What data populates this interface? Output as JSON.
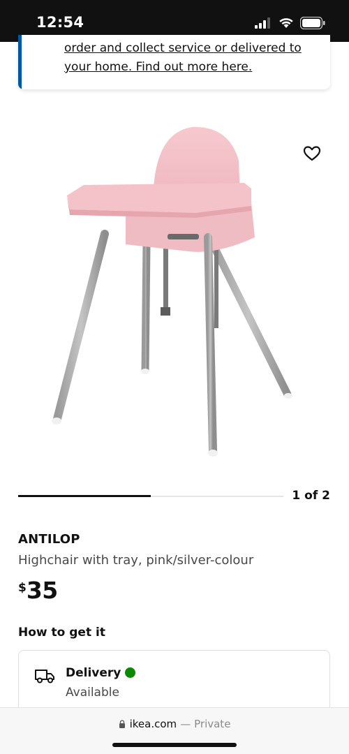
{
  "status_bar": {
    "time": "12:54",
    "icons": [
      "signal-icon",
      "wifi-icon",
      "battery-icon"
    ]
  },
  "info_banner": {
    "link_text": "order and collect service or delivered to your home. Find out more here.",
    "accent_color": "#0058a3"
  },
  "gallery": {
    "counter": "1 of 2",
    "progress": 0.5,
    "favourite_icon": "heart-outline-icon"
  },
  "product": {
    "name": "ANTILOP",
    "description": "Highchair with tray, pink/silver-colour",
    "price_currency": "$",
    "price_amount": "35"
  },
  "availability": {
    "section_title": "How to get it",
    "delivery": {
      "title": "Delivery",
      "status": "Available",
      "status_color": "#0a8a00",
      "icon": "truck-icon"
    }
  },
  "browser": {
    "domain": "ikea.com",
    "separator": "—",
    "mode": "Private"
  }
}
